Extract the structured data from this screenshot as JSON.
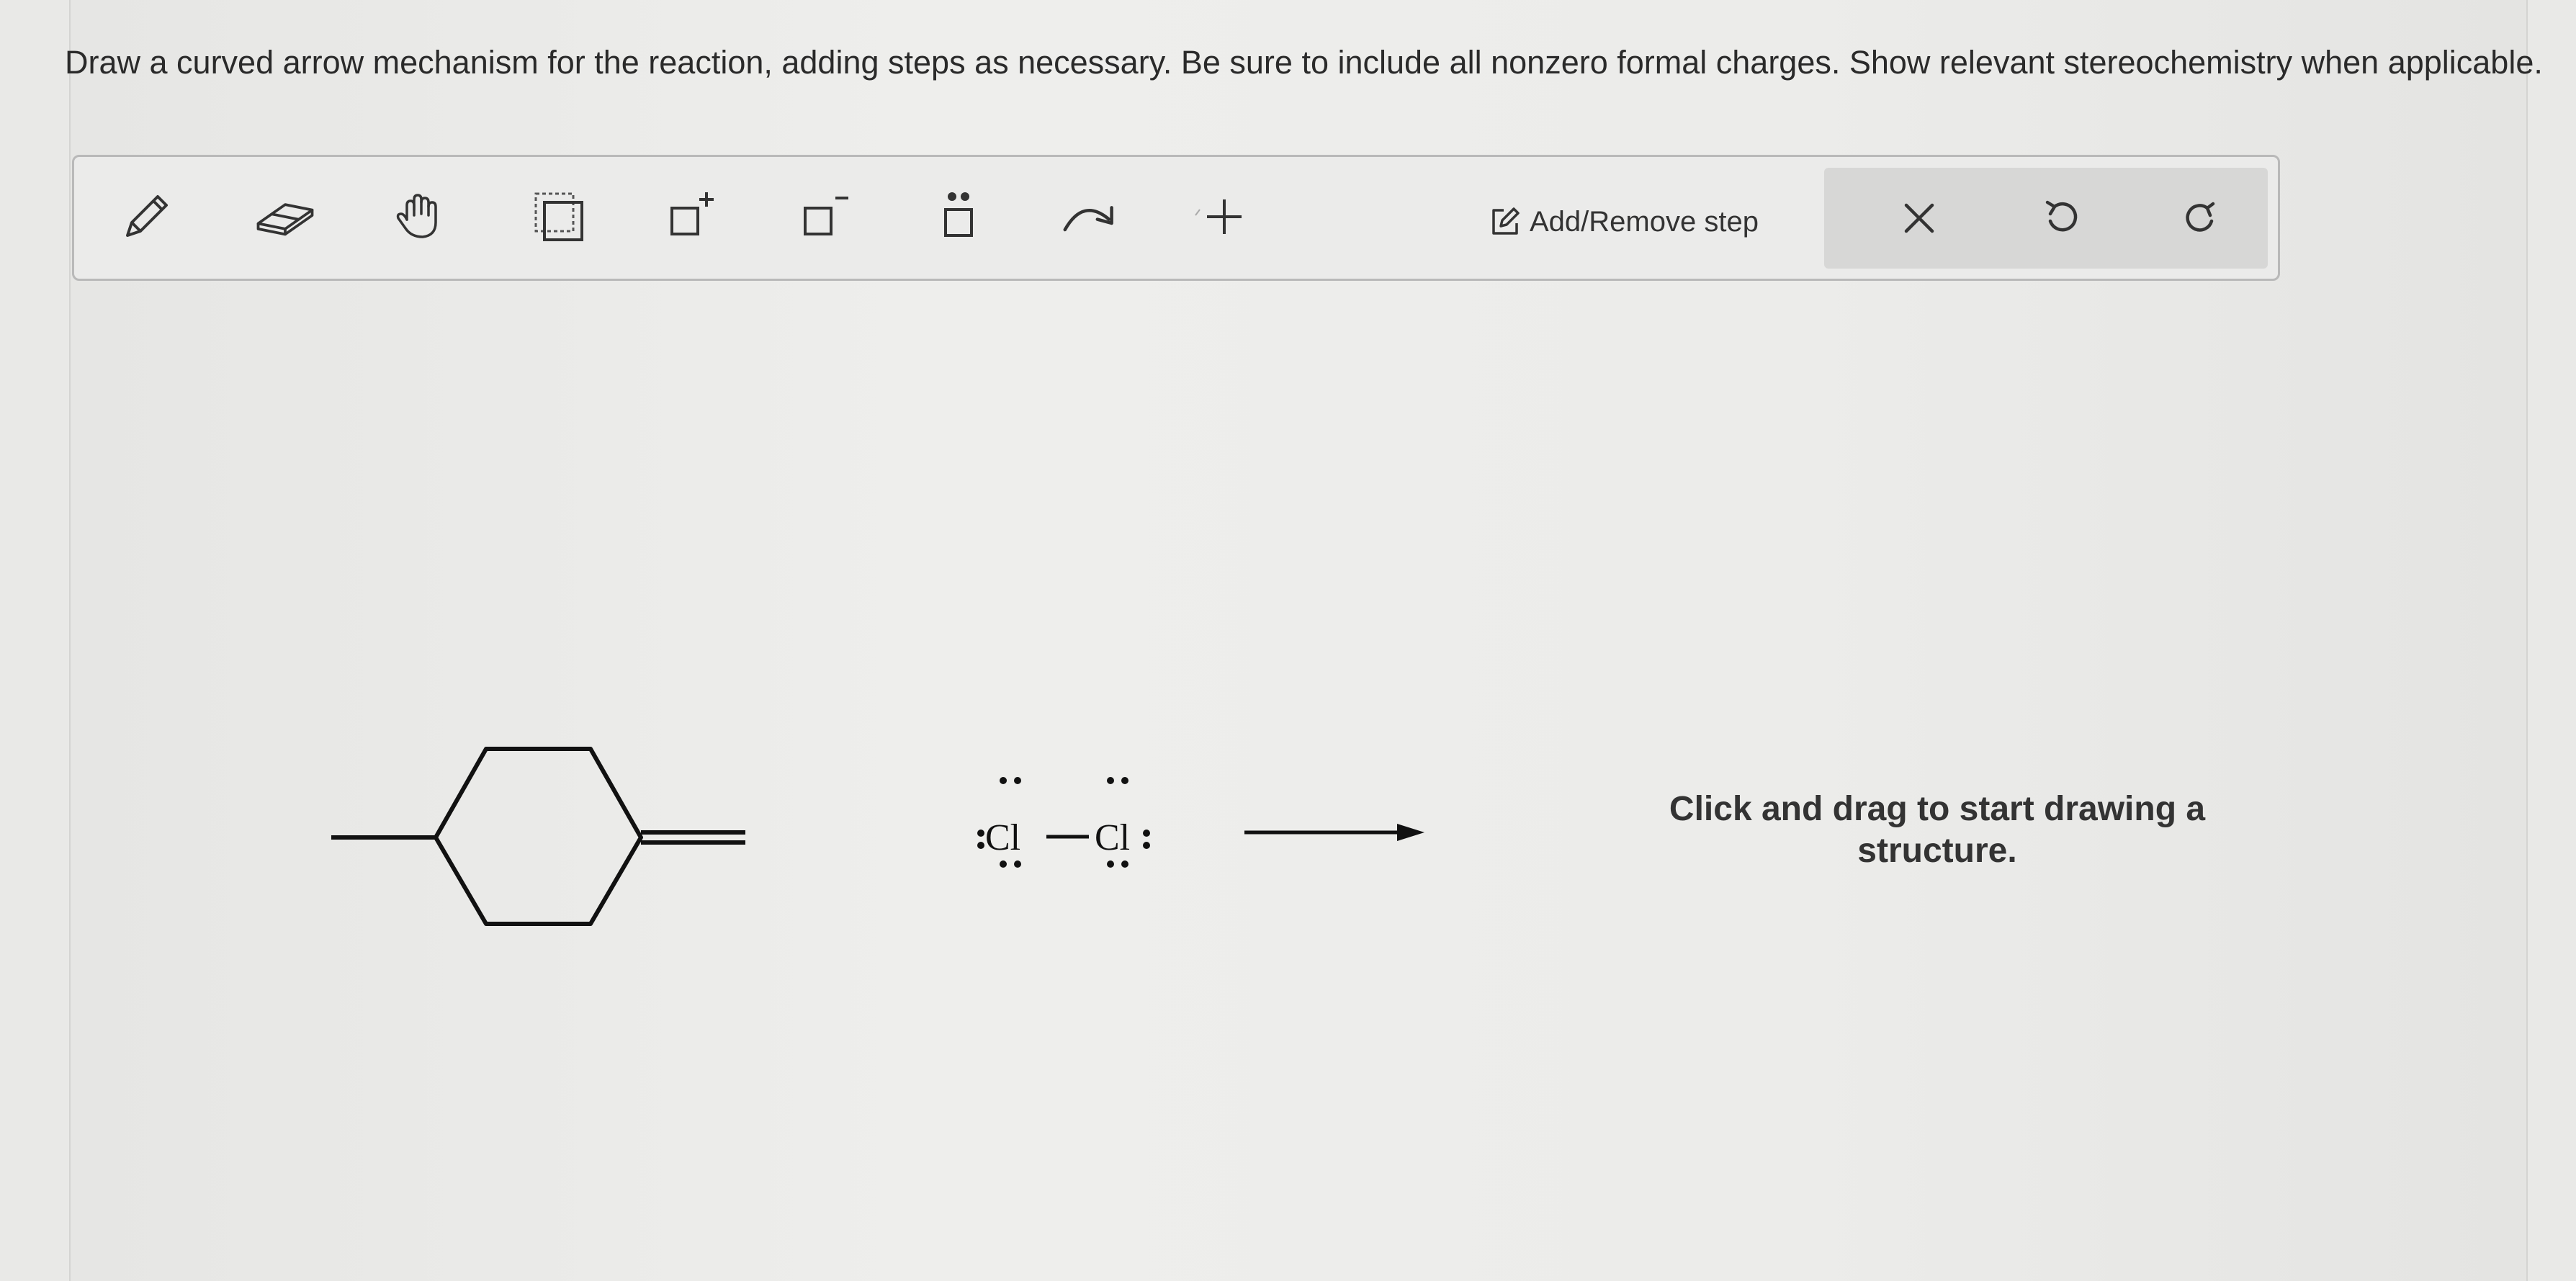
{
  "instructions": "Draw a curved arrow mechanism for the reaction, adding steps as necessary. Be sure to include all nonzero formal charges. Show relevant stereochemistry when applicable.",
  "toolbar": {
    "tools": [
      "pencil-icon",
      "eraser-icon",
      "hand-icon",
      "select-icon",
      "positive-charge-icon",
      "negative-charge-icon",
      "lone-pair-icon",
      "curved-arrow-icon",
      "add-plus-icon"
    ],
    "step_label": "Add/Remove step",
    "right_tools": [
      "close-icon",
      "undo-icon",
      "redo-icon"
    ]
  },
  "reaction": {
    "reactant_label": "Cl",
    "reactant_label_2": "Cl"
  },
  "canvas": {
    "hint": "Click and drag to start drawing a structure."
  }
}
